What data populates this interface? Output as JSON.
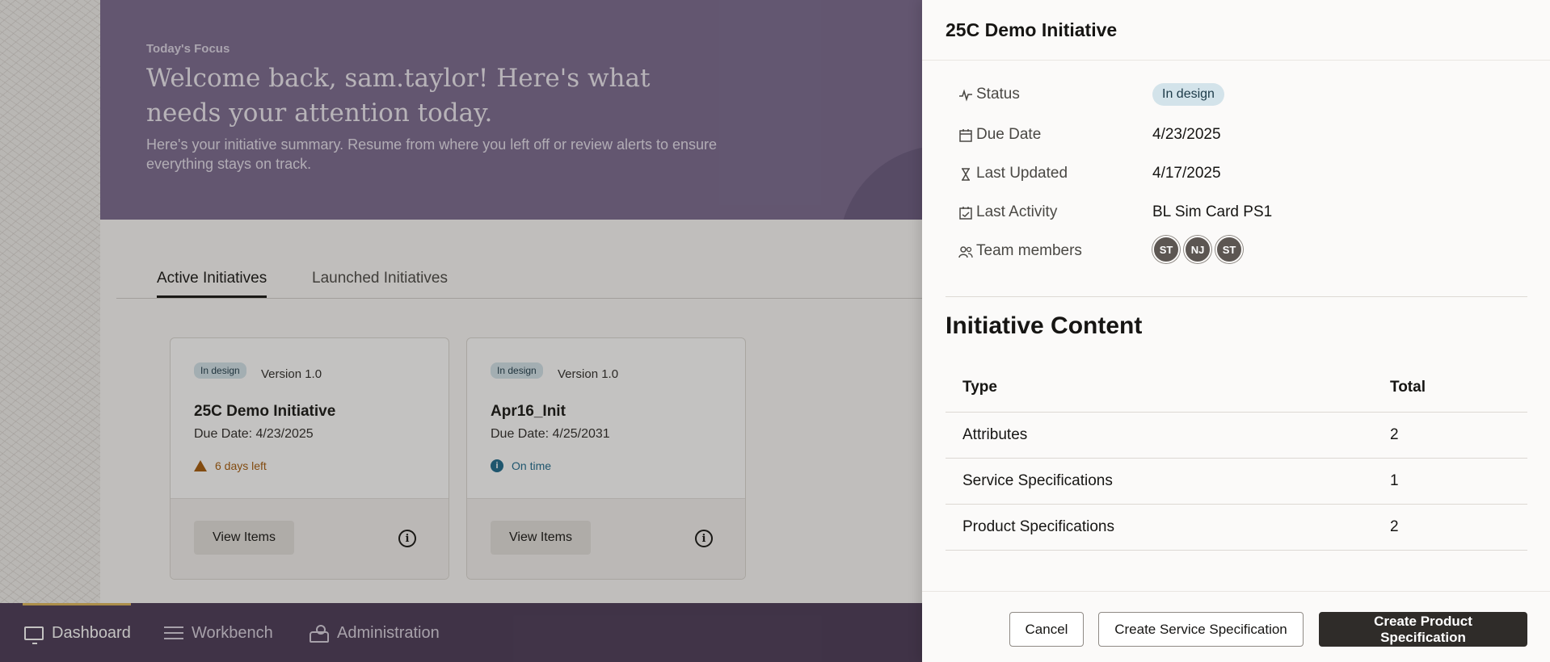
{
  "hero": {
    "eyebrow": "Today's Focus",
    "title": "Welcome back, sam.taylor! Here's what needs your attention today.",
    "subtitle": "Here's your initiative summary. Resume from where you left off or review alerts to ensure everything stays on track."
  },
  "tabs": [
    {
      "label": "Active Initiatives",
      "active": true
    },
    {
      "label": "Launched Initiatives",
      "active": false
    }
  ],
  "cards": [
    {
      "badge": "In design",
      "version": "Version 1.0",
      "title": "25C Demo Initiative",
      "due": "Due Date: 4/23/2025",
      "status": "6 days left",
      "status_type": "warning",
      "button": "View Items"
    },
    {
      "badge": "In design",
      "version": "Version 1.0",
      "title": "Apr16_Init",
      "due": "Due Date: 4/25/2031",
      "status": "On time",
      "status_type": "info",
      "button": "View Items"
    }
  ],
  "bottom_nav": [
    {
      "label": "Dashboard",
      "icon": "dashboard-icon",
      "active": true
    },
    {
      "label": "Workbench",
      "icon": "list-icon",
      "active": false
    },
    {
      "label": "Administration",
      "icon": "admin-icon",
      "active": false
    }
  ],
  "drawer": {
    "title": "25C Demo Initiative",
    "details": {
      "status_label": "Status",
      "status_value": "In design",
      "due_label": "Due Date",
      "due_value": "4/23/2025",
      "updated_label": "Last Updated",
      "updated_value": "4/17/2025",
      "activity_label": "Last Activity",
      "activity_value": "BL Sim Card PS1",
      "team_label": "Team members",
      "team": [
        "ST",
        "NJ",
        "ST"
      ]
    },
    "content_title": "Initiative Content",
    "table": {
      "headers": [
        "Type",
        "Total"
      ],
      "rows": [
        [
          "Attributes",
          "2"
        ],
        [
          "Service Specifications",
          "1"
        ],
        [
          "Product Specifications",
          "2"
        ]
      ]
    },
    "buttons": {
      "cancel": "Cancel",
      "create_service": "Create Service Specification",
      "create_product": "Create Product Specification"
    }
  },
  "colors": {
    "hero_bg": "#7a6a8f",
    "nav_bg": "#4a3a57",
    "nav_accent": "#e0b85a",
    "status_chip_bg": "#d3e3ea",
    "warning": "#a65b0b",
    "info": "#1d6a8c",
    "primary_button": "#2f2c29"
  }
}
